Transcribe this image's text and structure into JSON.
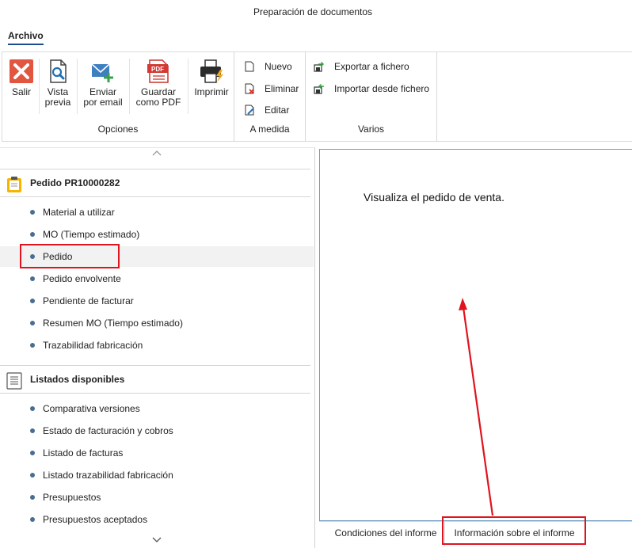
{
  "window": {
    "title": "Preparación de documentos"
  },
  "menu": {
    "archivo": "Archivo"
  },
  "ribbon": {
    "opciones": {
      "label": "Opciones",
      "buttons": [
        {
          "label": "Salir",
          "icon": "exit-x-icon"
        },
        {
          "label": "Vista\nprevia",
          "icon": "preview-icon"
        },
        {
          "label": "Enviar\npor email",
          "icon": "email-icon"
        },
        {
          "label": "Guardar\ncomo PDF",
          "icon": "pdf-icon"
        },
        {
          "label": "Imprimir",
          "icon": "printer-icon"
        }
      ]
    },
    "a_medida": {
      "label": "A medida",
      "buttons": [
        {
          "label": "Nuevo",
          "icon": "new-document-icon"
        },
        {
          "label": "Eliminar",
          "icon": "delete-document-icon"
        },
        {
          "label": "Editar",
          "icon": "edit-document-icon"
        }
      ]
    },
    "varios": {
      "label": "Varios",
      "buttons": [
        {
          "label": "Exportar a fichero",
          "icon": "export-icon"
        },
        {
          "label": "Importar desde fichero",
          "icon": "import-icon"
        }
      ]
    }
  },
  "left_panel": {
    "section1": {
      "title": "Pedido PR10000282",
      "items": [
        "Material a utilizar",
        "MO (Tiempo estimado)",
        "Pedido",
        "Pedido envolvente",
        "Pendiente de facturar",
        "Resumen MO (Tiempo estimado)",
        "Trazabilidad fabricación"
      ],
      "selected": "Pedido"
    },
    "section2": {
      "title": "Listados disponibles",
      "items": [
        "Comparativa versiones",
        "Estado de facturación y cobros",
        "Listado de facturas",
        "Listado trazabilidad fabricación",
        "Presupuestos",
        "Presupuestos aceptados"
      ]
    }
  },
  "right_panel": {
    "info": "Visualiza el pedido de venta."
  },
  "tabs": [
    {
      "label": "Condiciones del informe"
    },
    {
      "label": "Información sobre el informe"
    }
  ],
  "colors": {
    "highlight": "#e0141e",
    "accent": "#1a4c8f",
    "panel_border": "#6f9bc4"
  }
}
